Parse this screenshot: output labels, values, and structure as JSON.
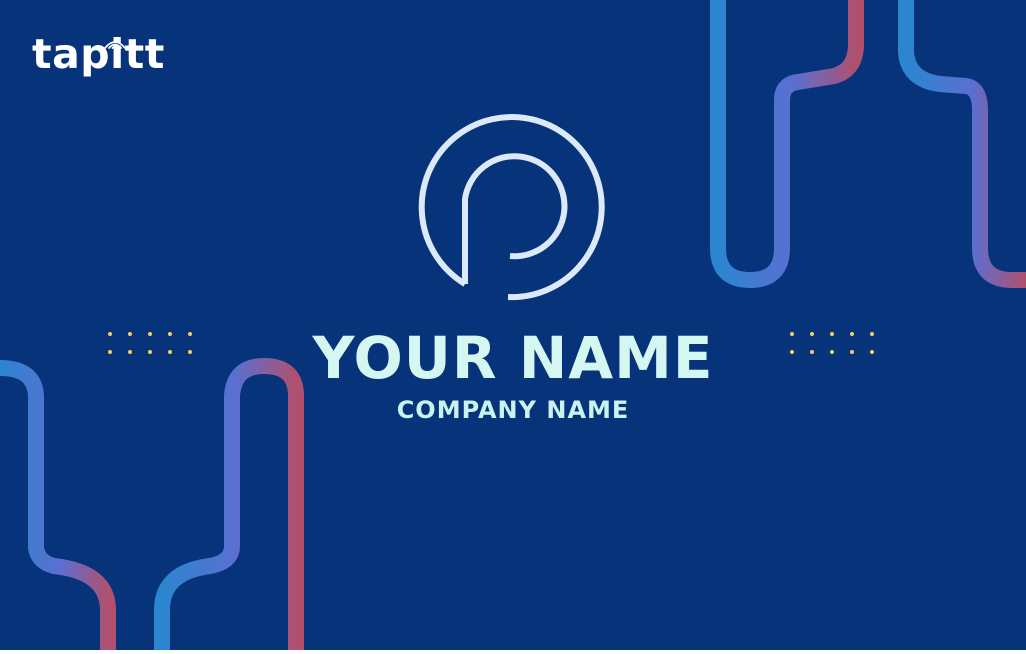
{
  "brand": {
    "logo_text": "tapitt"
  },
  "card": {
    "name": "YOUR NAME",
    "company": "COMPANY NAME"
  },
  "colors": {
    "background": "#06337a",
    "name_text": "#d4f7f1",
    "dots": "#f0d060",
    "gradient_start": "#2b86cf",
    "gradient_mid": "#5a6fd1",
    "gradient_end": "#b0506e",
    "emblem_stroke": "#dbe9fb"
  },
  "icons": [
    "wifi-icon",
    "p-circle-logo-icon"
  ]
}
